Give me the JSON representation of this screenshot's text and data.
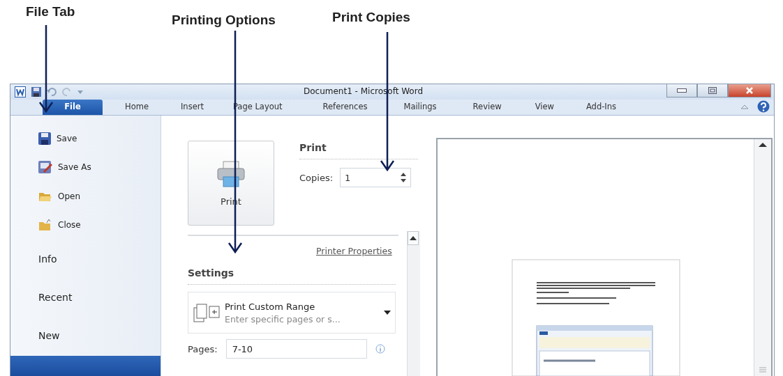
{
  "annotations": [
    {
      "label": "File Tab"
    },
    {
      "label": "Printing Options"
    },
    {
      "label": "Print Copies"
    }
  ],
  "window": {
    "title": "Document1 - Microsoft Word"
  },
  "ribbon_tabs": [
    {
      "label": "File",
      "selected": true
    },
    {
      "label": "Home",
      "selected": false
    },
    {
      "label": "Insert",
      "selected": false
    },
    {
      "label": "Page Layout",
      "selected": false
    },
    {
      "label": "References",
      "selected": false
    },
    {
      "label": "Mailings",
      "selected": false
    },
    {
      "label": "Review",
      "selected": false
    },
    {
      "label": "View",
      "selected": false
    },
    {
      "label": "Add-Ins",
      "selected": false
    }
  ],
  "nav": {
    "items": [
      {
        "kind": "command",
        "label": "Save",
        "selected": false
      },
      {
        "kind": "command",
        "label": "Save As",
        "selected": false
      },
      {
        "kind": "command",
        "label": "Open",
        "selected": false
      },
      {
        "kind": "command",
        "label": "Close",
        "selected": false
      },
      {
        "kind": "page",
        "label": "Info",
        "selected": false
      },
      {
        "kind": "page",
        "label": "Recent",
        "selected": false
      },
      {
        "kind": "page",
        "label": "New",
        "selected": false
      },
      {
        "kind": "page",
        "selected": true
      }
    ]
  },
  "print": {
    "button": "Print",
    "heading": "Print",
    "copies_label": "Copies:",
    "copies_value": "1",
    "printer_properties": "Printer Properties"
  },
  "settings": {
    "heading": "Settings",
    "dropdown": {
      "title": "Print Custom Range",
      "subtitle": "Enter specific pages or s..."
    },
    "pages_label": "Pages:",
    "pages_value": "7-10"
  }
}
